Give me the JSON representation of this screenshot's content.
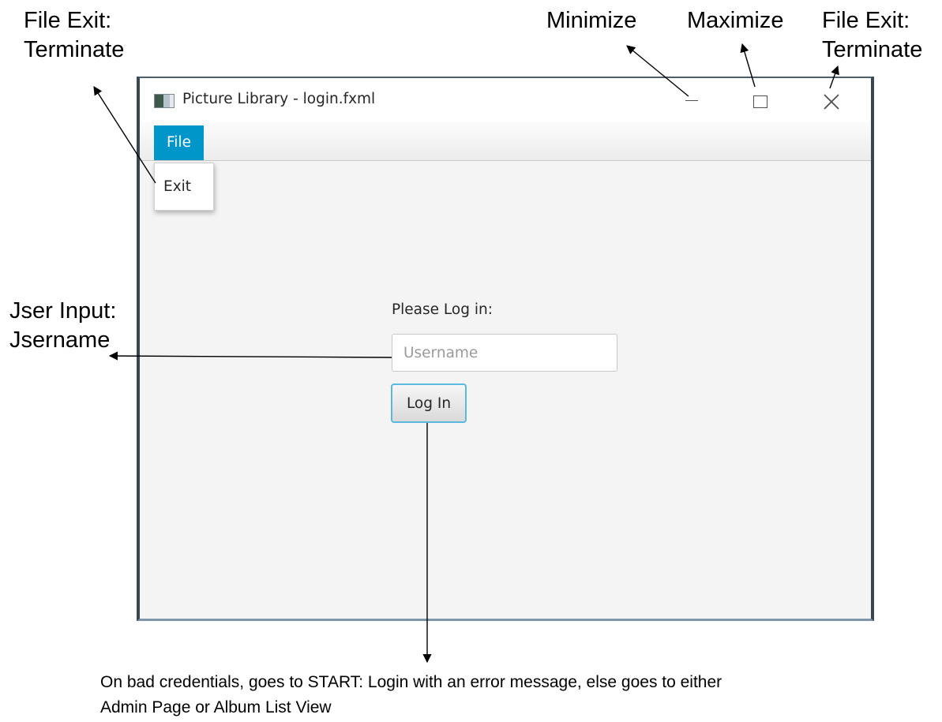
{
  "annotations": {
    "file_exit_left": {
      "line1": "File Exit:",
      "line2": "Terminate"
    },
    "minimize": "Minimize",
    "maximize": "Maximize",
    "file_exit_right": {
      "line1": "File Exit:",
      "line2": "Terminate"
    },
    "user_input": {
      "line1": "Jser Input:",
      "line2": "Jsername"
    },
    "bottom_note": {
      "line1": "On bad credentials, goes to START: Login with an error message, else goes to either",
      "line2": "Admin Page or Album List View"
    }
  },
  "window": {
    "title": "Picture Library - login.fxml",
    "icon": "app-window-icon",
    "controls": [
      "minimize-icon",
      "maximize-icon",
      "close-icon"
    ]
  },
  "menubar": {
    "menus": [
      {
        "label": "File",
        "items": [
          {
            "label": "Exit"
          }
        ]
      }
    ]
  },
  "login": {
    "prompt": "Please Log in:",
    "username_placeholder": "Username",
    "username_value": "",
    "login_button": "Log In"
  },
  "colors": {
    "menu_accent": "#0096c9",
    "button_focus_border": "#59b9de",
    "window_background": "#f4f4f4",
    "window_frame": "#3c4650"
  }
}
